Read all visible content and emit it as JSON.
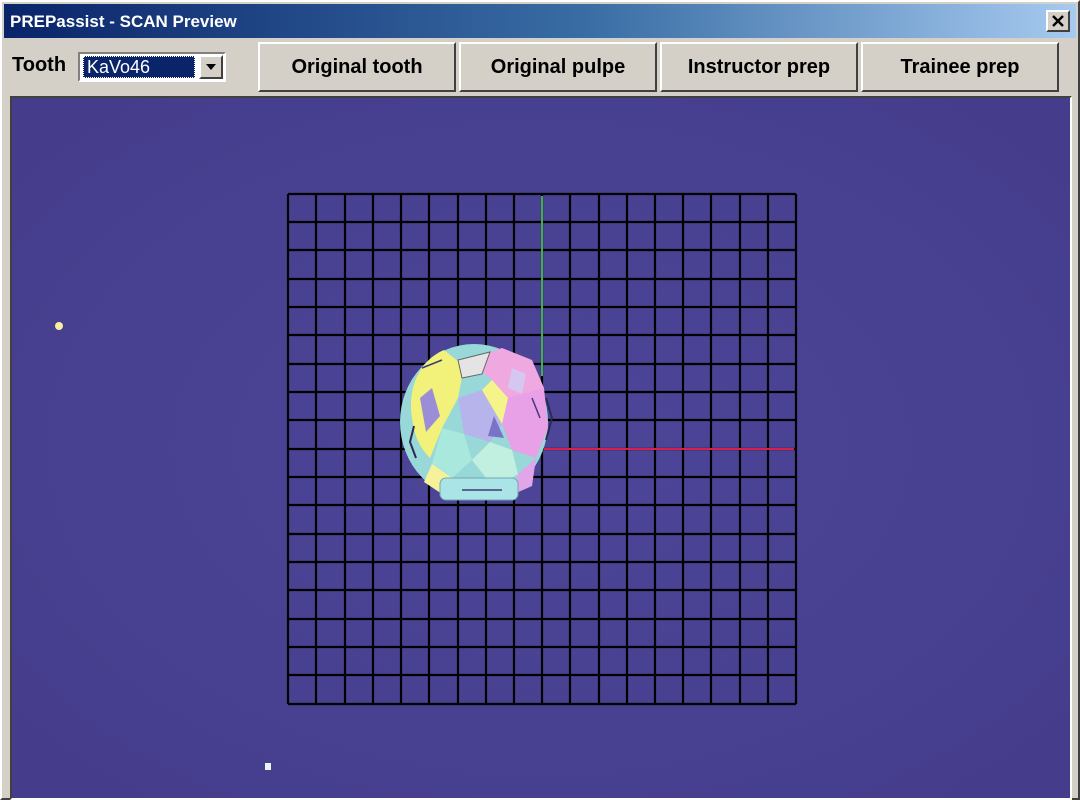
{
  "window": {
    "title": "PREPassist - SCAN Preview",
    "close_icon": "close-icon"
  },
  "toolbar": {
    "tooth_label": "Tooth",
    "tooth_select_value": "KaVo46",
    "buttons": {
      "original_tooth": "Original tooth",
      "original_pulpe": "Original pulpe",
      "instructor_prep": "Instructor prep",
      "trainee_prep": "Trainee prep"
    }
  },
  "viewport": {
    "background": "#4a4294",
    "grid_color": "#000000",
    "axis_vertical_color": "#3fb04f",
    "axis_horizontal_color": "#d4204a",
    "model": "scanned-tooth-3d-model"
  }
}
